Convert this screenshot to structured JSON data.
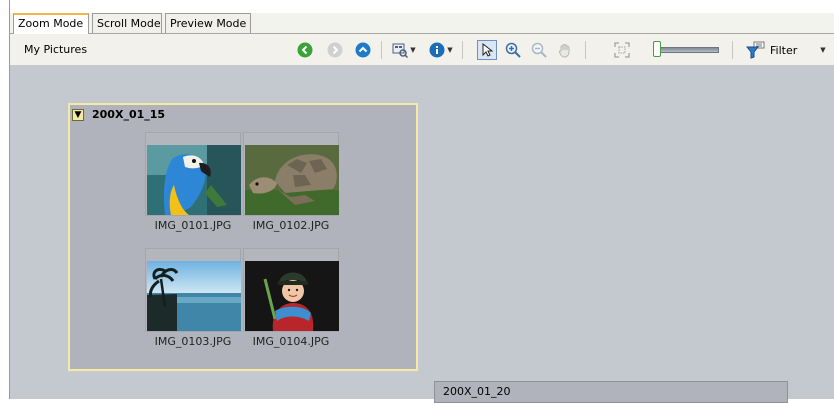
{
  "tabs": [
    {
      "label": "Zoom Mode",
      "active": true
    },
    {
      "label": "Scroll Mode",
      "active": false
    },
    {
      "label": "Preview Mode",
      "active": false
    }
  ],
  "toolbar": {
    "location": "My Pictures",
    "filter_label": "Filter",
    "icons": [
      "back-icon",
      "forward-icon",
      "up-icon",
      "view-icon",
      "info-icon",
      "select-icon",
      "zoom-in-icon",
      "zoom-out-icon",
      "pan-hand-icon",
      "fit-icon",
      "filter-icon"
    ]
  },
  "groups": [
    {
      "title": "200X_01_15",
      "items": [
        {
          "label": "IMG_0101.JPG"
        },
        {
          "label": "IMG_0102.JPG"
        },
        {
          "label": "IMG_0103.JPG"
        },
        {
          "label": "IMG_0104.JPG"
        }
      ]
    },
    {
      "title": "200X_01_20",
      "items": []
    }
  ],
  "colors": {
    "content_bg": "#c4c8cf",
    "group_bg": "#b1b3bc",
    "group_border_selected": "#f4eaa6",
    "tab_accent": "#f0b64a",
    "nav_green": "#39a33a",
    "nav_blue": "#1f7bc8"
  }
}
